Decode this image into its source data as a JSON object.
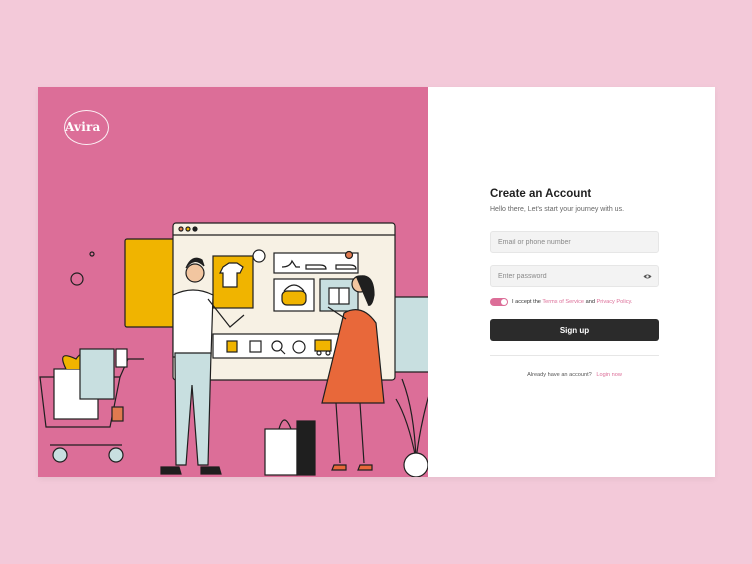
{
  "brand": {
    "name": "Avira",
    "colors": {
      "page_bg": "#f3c9d9",
      "panel": "#dc6e98",
      "accent": "#dc6e98",
      "button": "#2b2b2b"
    }
  },
  "form": {
    "title": "Create an Account",
    "subtitle": "Hello there, Let's start your journey with us.",
    "email_placeholder": "Email or phone number",
    "password_placeholder": "Enter password",
    "password_icon": "eye-icon",
    "terms": {
      "prefix": "I accept the",
      "terms_link": "Terms of Service",
      "and": "and",
      "privacy_link": "Privacy Policy."
    },
    "toggle_on": true,
    "submit_label": "Sign up",
    "login_prompt": "Already have an account?",
    "login_link": "Login now"
  },
  "illustration": {
    "icons": [
      "tshirt-icon",
      "heels-icon",
      "sneaker-icon",
      "handbag-icon",
      "gift-icon",
      "shopping-bag-icon",
      "search-icon",
      "globe-icon",
      "truck-icon",
      "price-tag-icon",
      "shopping-cart-icon",
      "plant-icon"
    ]
  }
}
